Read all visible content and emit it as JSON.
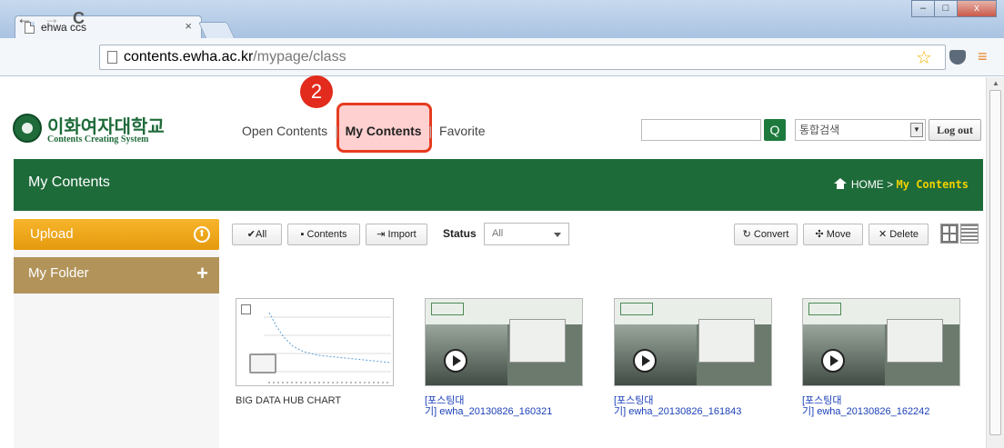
{
  "browser": {
    "tab_title": "ehwa ccs",
    "tab_close": "×",
    "url_host": "contents.ewha.ac.kr",
    "url_path": "/mypage/class",
    "window_buttons": [
      "–",
      "□",
      "x"
    ],
    "nav": {
      "back": "←",
      "forward": "→",
      "reload": "C"
    },
    "star": "☆",
    "menu": "≡"
  },
  "header": {
    "logo_name": "이화여자대학교",
    "logo_sub": "Contents Creating System",
    "nav_items": [
      "Open Contents",
      "My Contents",
      "Favorite"
    ],
    "nav_sep": "|",
    "active_nav": "My Contents",
    "callout_number": "2",
    "search_placeholder": "",
    "search_icon": "Q",
    "search_scope": "통합검색",
    "search_scope_caret": "▼",
    "logout_label": "Log out"
  },
  "banner": {
    "title": "My Contents",
    "crumb_home": "HOME",
    "crumb_sep": ">",
    "crumb_current": "My Contents"
  },
  "sidebar": {
    "upload_label": "Upload",
    "upload_icon": "⬆",
    "folder_label": "My Folder",
    "folder_add_icon": "+"
  },
  "toolbar": {
    "all_label": "✔All",
    "contents_label": "Contents",
    "import_label": "Import",
    "status_label": "Status",
    "status_value": "All",
    "convert_label": "Convert",
    "move_label": "Move",
    "delete_label": "Delete"
  },
  "items": [
    {
      "caption": "BIG DATA HUB CHART",
      "kind": "chart"
    },
    {
      "caption_title": "[포스팅대",
      "caption_rest": "기] ewha_20130826_160321",
      "kind": "video"
    },
    {
      "caption_title": "[포스팅대",
      "caption_rest": "기] ewha_20130826_161843",
      "kind": "video"
    },
    {
      "caption_title": "[포스팅대",
      "caption_rest": "기] ewha_20130826_162242",
      "kind": "video"
    }
  ],
  "colors": {
    "brand_green": "#1e6b3a",
    "upload_orange": "#f0a81d",
    "folder_tan": "#b2945b",
    "callout_red": "#e22b1c",
    "breadcrumb_yellow": "#f2d200"
  }
}
